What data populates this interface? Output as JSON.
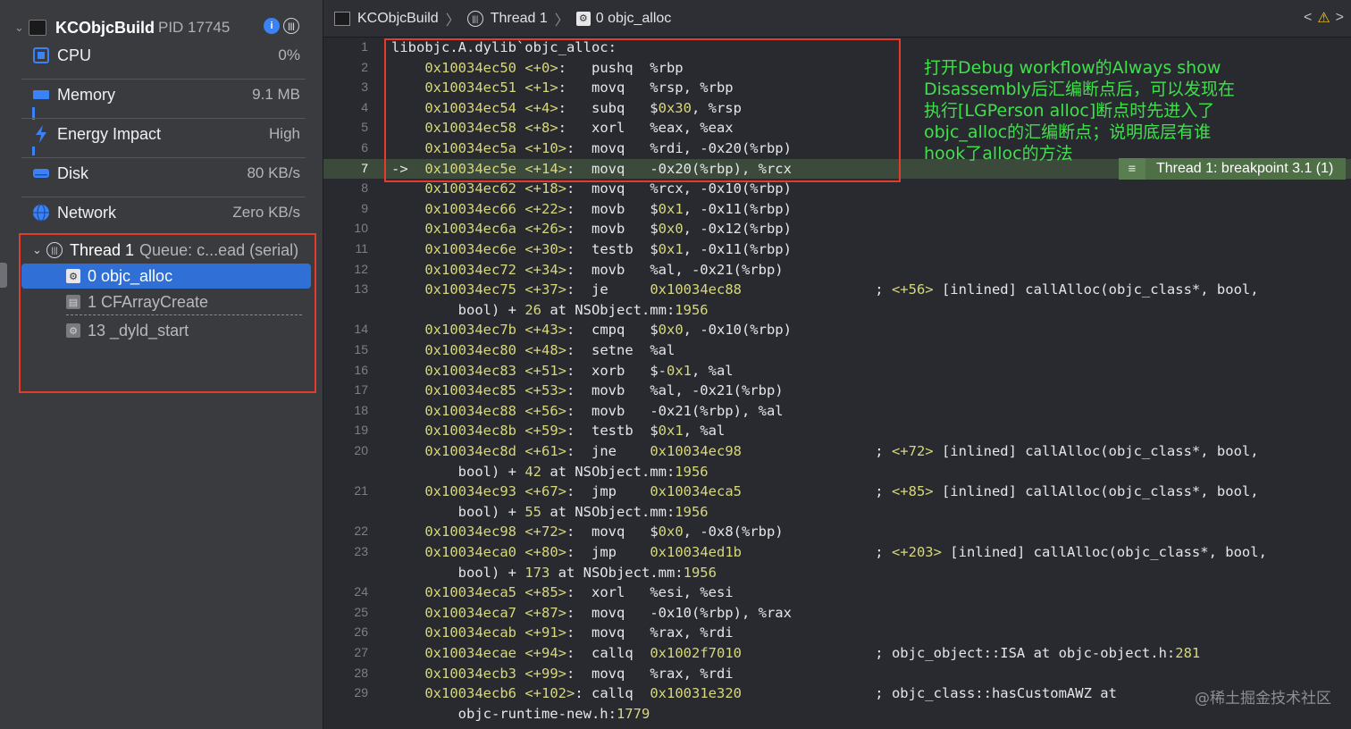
{
  "sidebar": {
    "app_name": "KCObjcBuild",
    "pid": "PID 17745",
    "gauges": [
      {
        "label": "CPU",
        "value": "0%",
        "icon": "cpu-icon"
      },
      {
        "label": "Memory",
        "value": "9.1 MB",
        "icon": "memory-icon"
      },
      {
        "label": "Energy Impact",
        "value": "High",
        "icon": "energy-icon"
      },
      {
        "label": "Disk",
        "value": "80 KB/s",
        "icon": "disk-icon"
      },
      {
        "label": "Network",
        "value": "Zero KB/s",
        "icon": "network-icon"
      }
    ],
    "thread": {
      "label": "Thread 1",
      "queue": "Queue: c...ead (serial)"
    },
    "frames": [
      {
        "label": "0 objc_alloc"
      },
      {
        "label": "1 CFArrayCreate"
      },
      {
        "label": "13 _dyld_start"
      }
    ]
  },
  "jumpbar": {
    "project": "KCObjcBuild",
    "thread": "Thread 1",
    "frame": "0 objc_alloc"
  },
  "colors": {
    "accent": "#2f6fd6",
    "annotation": "#e53b2c",
    "note": "#3fe04a",
    "breakpoint": "#4f7046"
  },
  "breakpoint_label": "Thread 1: breakpoint 3.1 (1)",
  "annotation_note": "打开Debug workflow的Always show Disassembly后汇编断点后，可以发现在执行[LGPerson alloc]断点时先进入了objc_alloc的汇编断点；说明底层有谁hook了alloc的方法",
  "watermark": "@稀土掘金技术社区",
  "code_lines": [
    {
      "n": "1",
      "text": "libobjc.A.dylib`objc_alloc:"
    },
    {
      "n": "2",
      "text": "    0x10034ec50 <+0>:   pushq  %rbp"
    },
    {
      "n": "3",
      "text": "    0x10034ec51 <+1>:   movq   %rsp, %rbp"
    },
    {
      "n": "4",
      "text": "    0x10034ec54 <+4>:   subq   $0x30, %rsp"
    },
    {
      "n": "5",
      "text": "    0x10034ec58 <+8>:   xorl   %eax, %eax"
    },
    {
      "n": "6",
      "text": "    0x10034ec5a <+10>:  movq   %rdi, -0x20(%rbp)"
    },
    {
      "n": "7",
      "text": "->  0x10034ec5e <+14>:  movq   -0x20(%rbp), %rcx"
    },
    {
      "n": "8",
      "text": "    0x10034ec62 <+18>:  movq   %rcx, -0x10(%rbp)"
    },
    {
      "n": "9",
      "text": "    0x10034ec66 <+22>:  movb   $0x1, -0x11(%rbp)"
    },
    {
      "n": "10",
      "text": "    0x10034ec6a <+26>:  movb   $0x0, -0x12(%rbp)"
    },
    {
      "n": "11",
      "text": "    0x10034ec6e <+30>:  testb  $0x1, -0x11(%rbp)"
    },
    {
      "n": "12",
      "text": "    0x10034ec72 <+34>:  movb   %al, -0x21(%rbp)"
    },
    {
      "n": "13",
      "text": "    0x10034ec75 <+37>:  je     0x10034ec88                ; <+56> [inlined] callAlloc(objc_class*, bool,"
    },
    {
      "n": "",
      "text": "        bool) + 26 at NSObject.mm:1956"
    },
    {
      "n": "14",
      "text": "    0x10034ec7b <+43>:  cmpq   $0x0, -0x10(%rbp)"
    },
    {
      "n": "15",
      "text": "    0x10034ec80 <+48>:  setne  %al"
    },
    {
      "n": "16",
      "text": "    0x10034ec83 <+51>:  xorb   $-0x1, %al"
    },
    {
      "n": "17",
      "text": "    0x10034ec85 <+53>:  movb   %al, -0x21(%rbp)"
    },
    {
      "n": "18",
      "text": "    0x10034ec88 <+56>:  movb   -0x21(%rbp), %al"
    },
    {
      "n": "19",
      "text": "    0x10034ec8b <+59>:  testb  $0x1, %al"
    },
    {
      "n": "20",
      "text": "    0x10034ec8d <+61>:  jne    0x10034ec98                ; <+72> [inlined] callAlloc(objc_class*, bool,"
    },
    {
      "n": "",
      "text": "        bool) + 42 at NSObject.mm:1956"
    },
    {
      "n": "21",
      "text": "    0x10034ec93 <+67>:  jmp    0x10034eca5                ; <+85> [inlined] callAlloc(objc_class*, bool,"
    },
    {
      "n": "",
      "text": "        bool) + 55 at NSObject.mm:1956"
    },
    {
      "n": "22",
      "text": "    0x10034ec98 <+72>:  movq   $0x0, -0x8(%rbp)"
    },
    {
      "n": "23",
      "text": "    0x10034eca0 <+80>:  jmp    0x10034ed1b                ; <+203> [inlined] callAlloc(objc_class*, bool,"
    },
    {
      "n": "",
      "text": "        bool) + 173 at NSObject.mm:1956"
    },
    {
      "n": "24",
      "text": "    0x10034eca5 <+85>:  xorl   %esi, %esi"
    },
    {
      "n": "25",
      "text": "    0x10034eca7 <+87>:  movq   -0x10(%rbp), %rax"
    },
    {
      "n": "26",
      "text": "    0x10034ecab <+91>:  movq   %rax, %rdi"
    },
    {
      "n": "27",
      "text": "    0x10034ecae <+94>:  callq  0x1002f7010                ; objc_object::ISA at objc-object.h:281"
    },
    {
      "n": "28",
      "text": "    0x10034ecb3 <+99>:  movq   %rax, %rdi"
    },
    {
      "n": "29",
      "text": "    0x10034ecb6 <+102>: callq  0x10031e320                ; objc_class::hasCustomAWZ at"
    },
    {
      "n": "",
      "text": "        objc-runtime-new.h:1779"
    }
  ]
}
